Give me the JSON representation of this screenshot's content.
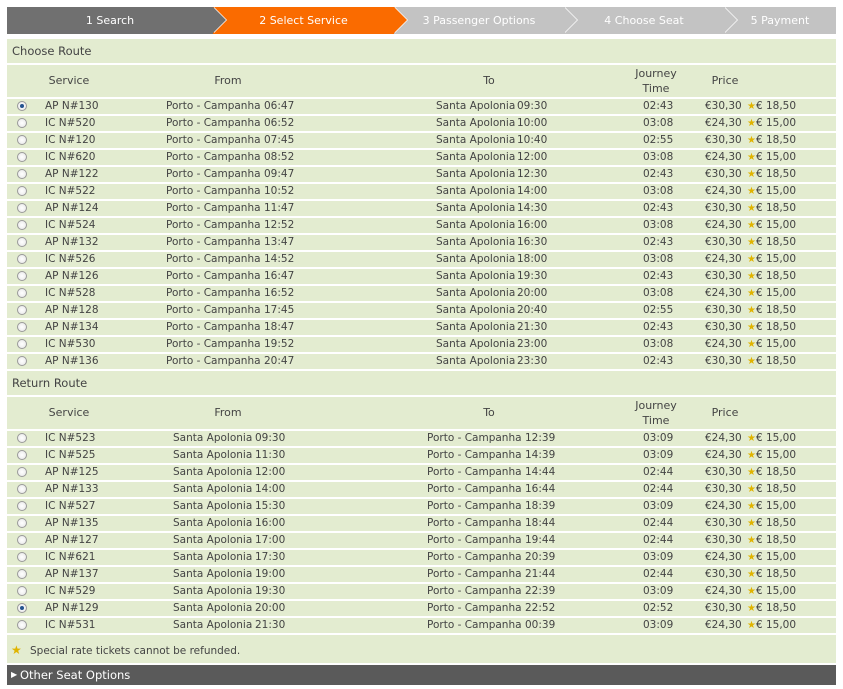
{
  "steps": [
    {
      "label": "1 Search",
      "state": "done"
    },
    {
      "label": "2 Select Service",
      "state": "active"
    },
    {
      "label": "3 Passenger Options",
      "state": "todo"
    },
    {
      "label": "4 Choose Seat",
      "state": "todo"
    },
    {
      "label": "5 Payment",
      "state": "todo"
    }
  ],
  "columns": {
    "service": "Service",
    "from": "From",
    "to": "To",
    "journey1": "Journey",
    "journey2": "Time",
    "price": "Price"
  },
  "outbound": {
    "title": "Choose Route",
    "rows": [
      {
        "service": "AP N#130",
        "from": "Porto - Campanha",
        "from_time": "06:47",
        "to": "Santa Apolonia",
        "to_time": "09:30",
        "journey": "02:43",
        "price": "€30,30",
        "special": "€ 18,50",
        "selected": true
      },
      {
        "service": "IC N#520",
        "from": "Porto - Campanha",
        "from_time": "06:52",
        "to": "Santa Apolonia",
        "to_time": "10:00",
        "journey": "03:08",
        "price": "€24,30",
        "special": "€ 15,00",
        "selected": false
      },
      {
        "service": "IC N#120",
        "from": "Porto - Campanha",
        "from_time": "07:45",
        "to": "Santa Apolonia",
        "to_time": "10:40",
        "journey": "02:55",
        "price": "€30,30",
        "special": "€ 18,50",
        "selected": false
      },
      {
        "service": "IC N#620",
        "from": "Porto - Campanha",
        "from_time": "08:52",
        "to": "Santa Apolonia",
        "to_time": "12:00",
        "journey": "03:08",
        "price": "€24,30",
        "special": "€ 15,00",
        "selected": false
      },
      {
        "service": "AP N#122",
        "from": "Porto - Campanha",
        "from_time": "09:47",
        "to": "Santa Apolonia",
        "to_time": "12:30",
        "journey": "02:43",
        "price": "€30,30",
        "special": "€ 18,50",
        "selected": false
      },
      {
        "service": "IC N#522",
        "from": "Porto - Campanha",
        "from_time": "10:52",
        "to": "Santa Apolonia",
        "to_time": "14:00",
        "journey": "03:08",
        "price": "€24,30",
        "special": "€ 15,00",
        "selected": false
      },
      {
        "service": "AP N#124",
        "from": "Porto - Campanha",
        "from_time": "11:47",
        "to": "Santa Apolonia",
        "to_time": "14:30",
        "journey": "02:43",
        "price": "€30,30",
        "special": "€ 18,50",
        "selected": false
      },
      {
        "service": "IC N#524",
        "from": "Porto - Campanha",
        "from_time": "12:52",
        "to": "Santa Apolonia",
        "to_time": "16:00",
        "journey": "03:08",
        "price": "€24,30",
        "special": "€ 15,00",
        "selected": false
      },
      {
        "service": "AP N#132",
        "from": "Porto - Campanha",
        "from_time": "13:47",
        "to": "Santa Apolonia",
        "to_time": "16:30",
        "journey": "02:43",
        "price": "€30,30",
        "special": "€ 18,50",
        "selected": false
      },
      {
        "service": "IC N#526",
        "from": "Porto - Campanha",
        "from_time": "14:52",
        "to": "Santa Apolonia",
        "to_time": "18:00",
        "journey": "03:08",
        "price": "€24,30",
        "special": "€ 15,00",
        "selected": false
      },
      {
        "service": "AP N#126",
        "from": "Porto - Campanha",
        "from_time": "16:47",
        "to": "Santa Apolonia",
        "to_time": "19:30",
        "journey": "02:43",
        "price": "€30,30",
        "special": "€ 18,50",
        "selected": false
      },
      {
        "service": "IC N#528",
        "from": "Porto - Campanha",
        "from_time": "16:52",
        "to": "Santa Apolonia",
        "to_time": "20:00",
        "journey": "03:08",
        "price": "€24,30",
        "special": "€ 15,00",
        "selected": false
      },
      {
        "service": "AP N#128",
        "from": "Porto - Campanha",
        "from_time": "17:45",
        "to": "Santa Apolonia",
        "to_time": "20:40",
        "journey": "02:55",
        "price": "€30,30",
        "special": "€ 18,50",
        "selected": false
      },
      {
        "service": "AP N#134",
        "from": "Porto - Campanha",
        "from_time": "18:47",
        "to": "Santa Apolonia",
        "to_time": "21:30",
        "journey": "02:43",
        "price": "€30,30",
        "special": "€ 18,50",
        "selected": false
      },
      {
        "service": "IC N#530",
        "from": "Porto - Campanha",
        "from_time": "19:52",
        "to": "Santa Apolonia",
        "to_time": "23:00",
        "journey": "03:08",
        "price": "€24,30",
        "special": "€ 15,00",
        "selected": false
      },
      {
        "service": "AP N#136",
        "from": "Porto - Campanha",
        "from_time": "20:47",
        "to": "Santa Apolonia",
        "to_time": "23:30",
        "journey": "02:43",
        "price": "€30,30",
        "special": "€ 18,50",
        "selected": false
      }
    ]
  },
  "return": {
    "title": "Return Route",
    "rows": [
      {
        "service": "IC N#523",
        "from": "Santa Apolonia",
        "from_time": "09:30",
        "to": "Porto - Campanha",
        "to_time": "12:39",
        "journey": "03:09",
        "price": "€24,30",
        "special": "€ 15,00",
        "selected": false
      },
      {
        "service": "IC N#525",
        "from": "Santa Apolonia",
        "from_time": "11:30",
        "to": "Porto - Campanha",
        "to_time": "14:39",
        "journey": "03:09",
        "price": "€24,30",
        "special": "€ 15,00",
        "selected": false
      },
      {
        "service": "AP N#125",
        "from": "Santa Apolonia",
        "from_time": "12:00",
        "to": "Porto - Campanha",
        "to_time": "14:44",
        "journey": "02:44",
        "price": "€30,30",
        "special": "€ 18,50",
        "selected": false
      },
      {
        "service": "AP N#133",
        "from": "Santa Apolonia",
        "from_time": "14:00",
        "to": "Porto - Campanha",
        "to_time": "16:44",
        "journey": "02:44",
        "price": "€30,30",
        "special": "€ 18,50",
        "selected": false
      },
      {
        "service": "IC N#527",
        "from": "Santa Apolonia",
        "from_time": "15:30",
        "to": "Porto - Campanha",
        "to_time": "18:39",
        "journey": "03:09",
        "price": "€24,30",
        "special": "€ 15,00",
        "selected": false
      },
      {
        "service": "AP N#135",
        "from": "Santa Apolonia",
        "from_time": "16:00",
        "to": "Porto - Campanha",
        "to_time": "18:44",
        "journey": "02:44",
        "price": "€30,30",
        "special": "€ 18,50",
        "selected": false
      },
      {
        "service": "AP N#127",
        "from": "Santa Apolonia",
        "from_time": "17:00",
        "to": "Porto - Campanha",
        "to_time": "19:44",
        "journey": "02:44",
        "price": "€30,30",
        "special": "€ 18,50",
        "selected": false
      },
      {
        "service": "IC N#621",
        "from": "Santa Apolonia",
        "from_time": "17:30",
        "to": "Porto - Campanha",
        "to_time": "20:39",
        "journey": "03:09",
        "price": "€24,30",
        "special": "€ 15,00",
        "selected": false
      },
      {
        "service": "AP N#137",
        "from": "Santa Apolonia",
        "from_time": "19:00",
        "to": "Porto - Campanha",
        "to_time": "21:44",
        "journey": "02:44",
        "price": "€30,30",
        "special": "€ 18,50",
        "selected": false
      },
      {
        "service": "IC N#529",
        "from": "Santa Apolonia",
        "from_time": "19:30",
        "to": "Porto - Campanha",
        "to_time": "22:39",
        "journey": "03:09",
        "price": "€24,30",
        "special": "€ 15,00",
        "selected": false
      },
      {
        "service": "AP N#129",
        "from": "Santa Apolonia",
        "from_time": "20:00",
        "to": "Porto - Campanha",
        "to_time": "22:52",
        "journey": "02:52",
        "price": "€30,30",
        "special": "€ 18,50",
        "selected": true
      },
      {
        "service": "IC N#531",
        "from": "Santa Apolonia",
        "from_time": "21:30",
        "to": "Porto - Campanha",
        "to_time": "00:39",
        "journey": "03:09",
        "price": "€24,30",
        "special": "€ 15,00",
        "selected": false
      }
    ]
  },
  "note": {
    "text": "Special rate tickets cannot be refunded.",
    "icon": "star-icon"
  },
  "other_options": {
    "label": "Other Seat Options",
    "icon": "triangle-right-icon"
  },
  "colors": {
    "active_step": "#fa6b00",
    "done_step": "#707070",
    "todo_step": "#c3c3c3",
    "panel": "#e3ecd0",
    "star": "#e0b400"
  }
}
